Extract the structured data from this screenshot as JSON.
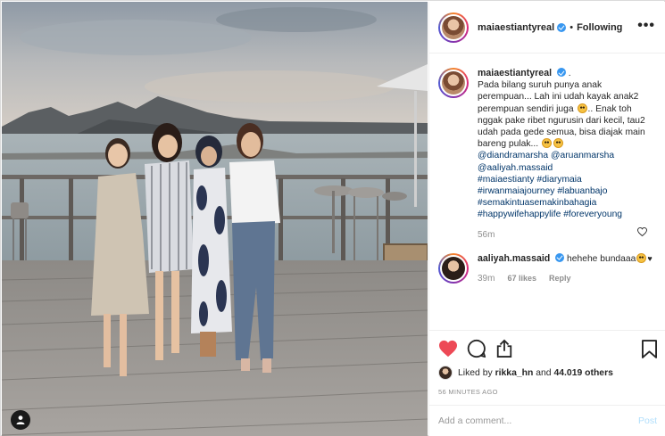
{
  "post": {
    "author": "maiaestiantyreal",
    "follow_status": "Following",
    "more_label": "•••",
    "caption_line1": "Pada bilang suruh punya anak perempuan... Lah ini udah kayak anak2 perempuan sendiri juga",
    "caption_line2": ".. Enak toh nggak pake ribet ngurusin dari kecil, tau2 udah pada gede semua, bisa diajak main bareng pulak...",
    "mentions": [
      "@diandramarsha",
      "@aruanmarsha",
      "@aaliyah.massaid"
    ],
    "hashtags": [
      "#maiaestianty",
      "#diarymaia",
      "#irwanmaiajourney",
      "#labuanbajo",
      "#semakintuasemakinbahagia",
      "#happywifehappylife",
      "#foreveryoung"
    ],
    "caption_time": "56m"
  },
  "reply": {
    "author": "aaliyah.massaid",
    "text": "hehehe bundaaa",
    "time": "39m",
    "likes": "67 likes",
    "reply_label": "Reply"
  },
  "engagement": {
    "liked_by_prefix": "Liked by",
    "liked_by_user": "rikka_hn",
    "liked_by_suffix": "and",
    "others_count": "44.019 others",
    "posted": "56 MINUTES AGO"
  },
  "comment_box": {
    "placeholder": "Add a comment...",
    "post_label": "Post"
  },
  "colors": {
    "heart": "#ed4956",
    "link": "#003569",
    "verified": "#3897f0",
    "post_button": "#b2dffc"
  },
  "icons": [
    "verified-badge-icon",
    "heart-filled-icon",
    "comment-icon",
    "share-icon",
    "bookmark-icon",
    "heart-outline-icon",
    "user-tag-icon"
  ]
}
